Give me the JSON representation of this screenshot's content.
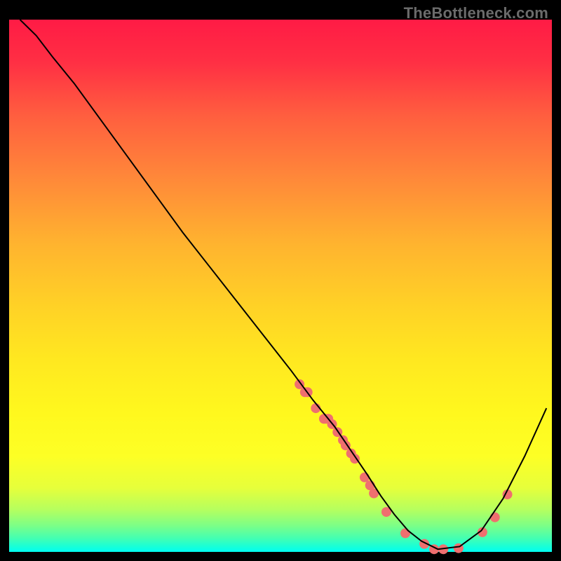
{
  "watermark": {
    "text": "TheBottleneck.com"
  },
  "chart_data": {
    "type": "line",
    "title": "",
    "xlabel": "",
    "ylabel": "",
    "xlim": [
      0,
      100
    ],
    "ylim": [
      0,
      100
    ],
    "grid": false,
    "series": [
      {
        "name": "curve",
        "x": [
          2,
          5,
          8,
          12,
          17,
          22,
          27,
          32,
          37,
          42,
          47,
          52,
          56,
          60,
          63,
          66,
          68.5,
          71,
          73.5,
          76,
          79,
          83,
          87,
          91,
          95,
          99
        ],
        "y": [
          100,
          97,
          93,
          88,
          81,
          74,
          67,
          60,
          53.5,
          47,
          40.5,
          34,
          28.5,
          23.5,
          19,
          14.5,
          10.5,
          7,
          4,
          2,
          0.5,
          1,
          4,
          10,
          18,
          27
        ],
        "stroke": "#000000",
        "stroke_width": 2
      }
    ],
    "scatter_points": {
      "name": "markers",
      "color": "#ef6f6f",
      "radius": 7,
      "points": [
        {
          "x": 53.5,
          "y": 31.5
        },
        {
          "x": 54.5,
          "y": 30
        },
        {
          "x": 55.0,
          "y": 30
        },
        {
          "x": 56.5,
          "y": 27
        },
        {
          "x": 58.0,
          "y": 25
        },
        {
          "x": 58.3,
          "y": 25
        },
        {
          "x": 58.8,
          "y": 25
        },
        {
          "x": 59.5,
          "y": 24
        },
        {
          "x": 60.5,
          "y": 22.5
        },
        {
          "x": 61.5,
          "y": 21
        },
        {
          "x": 62.0,
          "y": 20
        },
        {
          "x": 63.0,
          "y": 18.5
        },
        {
          "x": 63.7,
          "y": 17.5
        },
        {
          "x": 65.5,
          "y": 14
        },
        {
          "x": 66.5,
          "y": 12.5
        },
        {
          "x": 67.2,
          "y": 11
        },
        {
          "x": 69.5,
          "y": 7.5
        },
        {
          "x": 73.0,
          "y": 3.5
        },
        {
          "x": 76.5,
          "y": 1.5
        },
        {
          "x": 78.3,
          "y": 0.5
        },
        {
          "x": 80.0,
          "y": 0.5
        },
        {
          "x": 82.8,
          "y": 0.7
        },
        {
          "x": 87.2,
          "y": 3.7
        },
        {
          "x": 89.5,
          "y": 6.5
        },
        {
          "x": 91.8,
          "y": 10.8
        }
      ]
    }
  }
}
